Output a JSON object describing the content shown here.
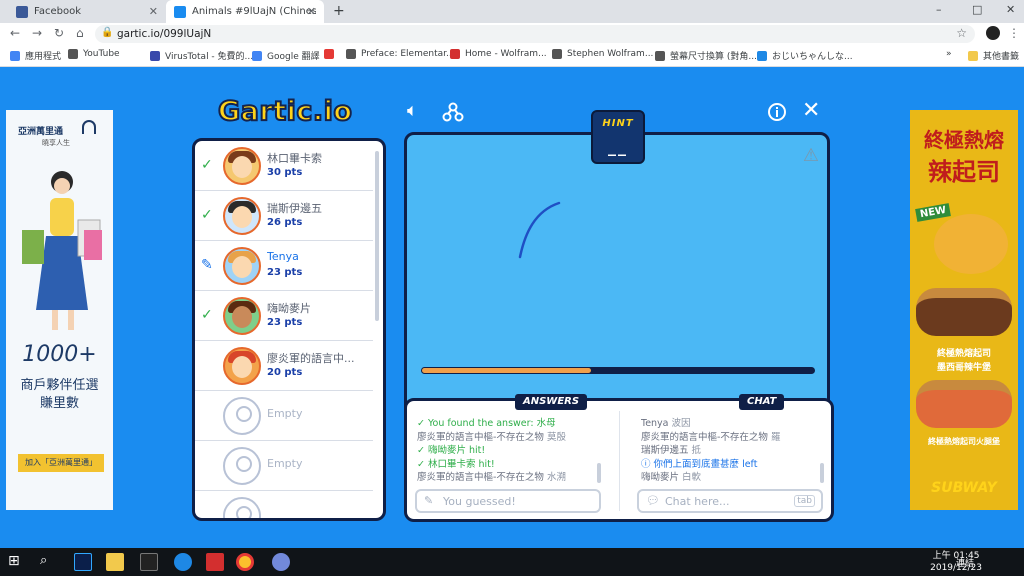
{
  "browser": {
    "tabs": [
      {
        "title": "Facebook",
        "icon": "facebook-icon",
        "color": "#3b5998"
      },
      {
        "title": "Animals #9lUajN (Chinese (Taiwan))",
        "icon": "gartic-icon",
        "color": "#1a8cf0"
      }
    ],
    "new_tab": "+",
    "window_controls": [
      "–",
      "□",
      "✕"
    ],
    "url": "gartic.io/099lUajN",
    "bookmarks": [
      {
        "label": "應用程式",
        "color": "#4285f4"
      },
      {
        "label": "YouTube",
        "color": "#555555"
      },
      {
        "label": "VirusTotal - 免費的...",
        "color": "#3949ab"
      },
      {
        "label": "Google 翻譯",
        "color": "#4285f4"
      },
      {
        "label": "",
        "color": "#e53935"
      },
      {
        "label": "Preface: Elementar...",
        "color": "#555555"
      },
      {
        "label": "Home - Wolfram...",
        "color": "#d32f2f"
      },
      {
        "label": "Stephen Wolfram...",
        "color": "#555555"
      },
      {
        "label": "螢幕尺寸換算 (對角...",
        "color": "#555555"
      },
      {
        "label": "おじいちゃんしな...",
        "color": "#1e88e5"
      }
    ],
    "more_bookmarks": "»",
    "other_bookmarks": "其他書籤"
  },
  "game": {
    "logo": "Gartic.io",
    "hint_label": "HINT",
    "hint_value": "__",
    "timer_progress": 0.43,
    "players": [
      {
        "name": "林口畢卡索",
        "points": "30 pts",
        "status": "guessed"
      },
      {
        "name": "瑞斯伊邊五",
        "points": "26 pts",
        "status": "guessed"
      },
      {
        "name": "Tenya",
        "points": "23 pts",
        "status": "drawing"
      },
      {
        "name": "嗨呦麥片",
        "points": "23 pts",
        "status": "guessed"
      },
      {
        "name": "廖炎軍的語言中...",
        "points": "20 pts",
        "status": "none"
      }
    ],
    "empty_slots": [
      "Empty",
      "Empty"
    ],
    "answers_label": "ANSWERS",
    "chat_label": "CHAT",
    "answers": [
      {
        "user": "",
        "text": "You found the answer: 水母",
        "style": "green"
      },
      {
        "user": "廖炎軍的語言中樞-不存在之物",
        "text": "莫殷",
        "style": "normal"
      },
      {
        "user": "",
        "text": "嗨呦麥片 hit!",
        "style": "green"
      },
      {
        "user": "",
        "text": "林口畢卡索 hit!",
        "style": "green"
      },
      {
        "user": "廖炎軍的語言中樞-不存在之物",
        "text": "水溯",
        "style": "normal"
      }
    ],
    "chat": [
      {
        "user": "Tenya",
        "text": "波因",
        "style": "normal"
      },
      {
        "user": "廖炎軍的語言中樞-不存在之物",
        "text": "羅",
        "style": "normal"
      },
      {
        "user": "瑞斯伊邊五",
        "text": "抵",
        "style": "normal"
      },
      {
        "user": "",
        "text": "你們上面到底畫甚麼 left",
        "style": "blue"
      },
      {
        "user": "嗨呦麥片",
        "text": "白軟",
        "style": "normal"
      }
    ],
    "answer_placeholder": "You guessed!",
    "chat_placeholder": "Chat here...",
    "tab_key": "tab"
  },
  "ads": {
    "left": {
      "brand": "亞洲萬里通",
      "tagline": "曉享人生",
      "headline": "1000+",
      "line1": "商戶夥伴任選",
      "line2": "賺里數",
      "cta": "加入「亞洲萬里通」"
    },
    "right": {
      "headline1": "終極熱熔",
      "headline2": "辣起司",
      "badge": "NEW",
      "sub1": "終極熱熔起司",
      "sub2": "墨西哥辣牛堡",
      "sub3": "終極熱熔起司火腿堡",
      "brand": "SUBWAY"
    }
  },
  "taskbar": {
    "tray": "連結",
    "time": "上午 01:45",
    "date": "2019/12/23"
  }
}
